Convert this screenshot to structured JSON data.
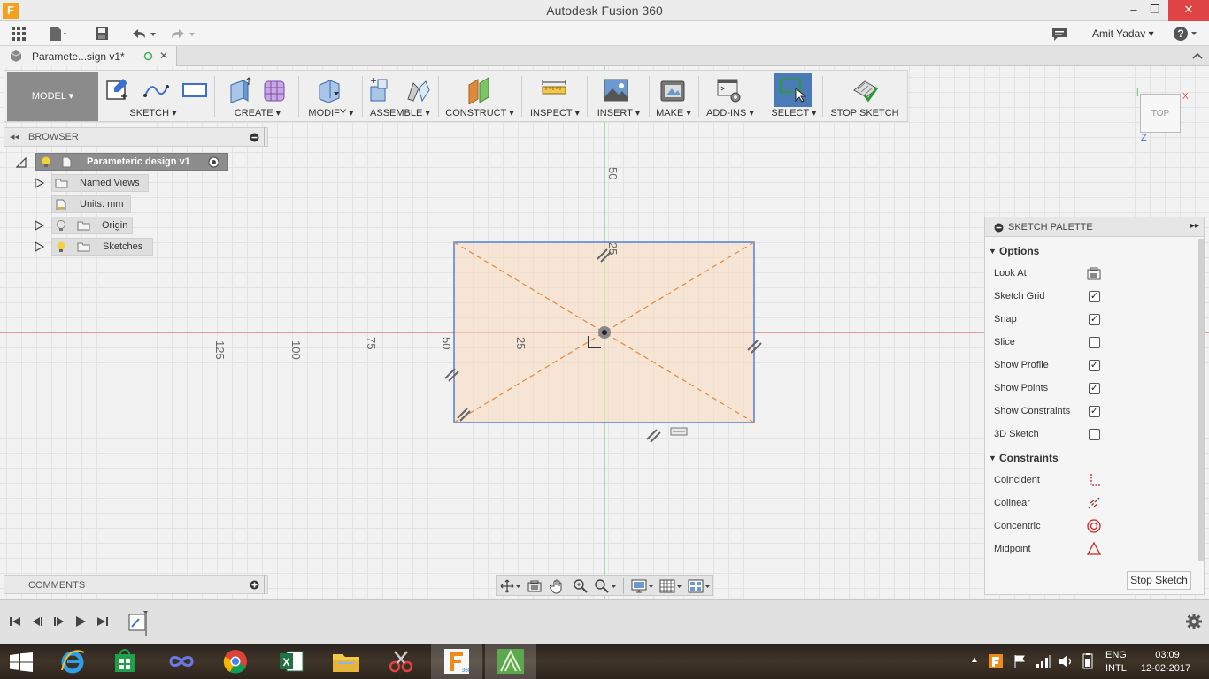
{
  "window": {
    "title": "Autodesk Fusion 360",
    "app_icon": "F",
    "minimize": "–",
    "maximize": "❐",
    "close": "✕"
  },
  "quick_access": {
    "user": "Amit Yadav ▾",
    "icons": [
      "grid-icon",
      "file-icon",
      "save-icon",
      "undo-icon",
      "redo-icon",
      "chat-icon",
      "help-icon"
    ]
  },
  "document_tab": {
    "label": "Paramete...sign v1*",
    "close": "✕"
  },
  "toolbar": {
    "model_label": "MODEL ▾",
    "groups": [
      {
        "label": "SKETCH ▾"
      },
      {
        "label": "CREATE ▾"
      },
      {
        "label": "MODIFY ▾"
      },
      {
        "label": "ASSEMBLE ▾"
      },
      {
        "label": "CONSTRUCT ▾"
      },
      {
        "label": "INSPECT ▾"
      },
      {
        "label": "INSERT ▾"
      },
      {
        "label": "MAKE ▾"
      },
      {
        "label": "ADD-INS ▾"
      },
      {
        "label": "SELECT ▾"
      },
      {
        "label": "STOP SKETCH"
      }
    ]
  },
  "browser": {
    "title": "BROWSER",
    "root": "Parameteric design v1",
    "items": [
      {
        "label": "Named Views"
      },
      {
        "label": "Units: mm"
      },
      {
        "label": "Origin"
      },
      {
        "label": "Sketches"
      }
    ]
  },
  "comments": {
    "title": "COMMENTS"
  },
  "viewcube": {
    "face": "TOP",
    "axis_x": "X",
    "axis_z": "Z"
  },
  "canvas": {
    "ruler_labels": [
      "125",
      "100",
      "75",
      "50",
      "25",
      "50",
      "25"
    ]
  },
  "sketch_palette": {
    "title": "SKETCH PALETTE",
    "options_header": "Options",
    "options": [
      {
        "label": "Look At",
        "type": "icon"
      },
      {
        "label": "Sketch Grid",
        "type": "check",
        "checked": true
      },
      {
        "label": "Snap",
        "type": "check",
        "checked": true
      },
      {
        "label": "Slice",
        "type": "check",
        "checked": false
      },
      {
        "label": "Show Profile",
        "type": "check",
        "checked": true
      },
      {
        "label": "Show Points",
        "type": "check",
        "checked": true
      },
      {
        "label": "Show Constraints",
        "type": "check",
        "checked": true
      },
      {
        "label": "3D Sketch",
        "type": "check",
        "checked": false
      }
    ],
    "constraints_header": "Constraints",
    "constraints": [
      {
        "label": "Coincident",
        "icon": "coincident-icon"
      },
      {
        "label": "Colinear",
        "icon": "colinear-icon"
      },
      {
        "label": "Concentric",
        "icon": "concentric-icon"
      },
      {
        "label": "Midpoint",
        "icon": "midpoint-icon"
      }
    ],
    "stop_button": "Stop Sketch"
  },
  "taskbar": {
    "lang1": "ENG",
    "lang2": "INTL",
    "time": "03:09",
    "date": "12-02-2017"
  },
  "colors": {
    "sketch_line": "#3b6fd6",
    "profile_fill": "#f8dcc2",
    "construction_line": "#e08a3c",
    "x_axis": "#e03030",
    "y_axis": "#44c044",
    "select_active": "#4b7bb6"
  }
}
